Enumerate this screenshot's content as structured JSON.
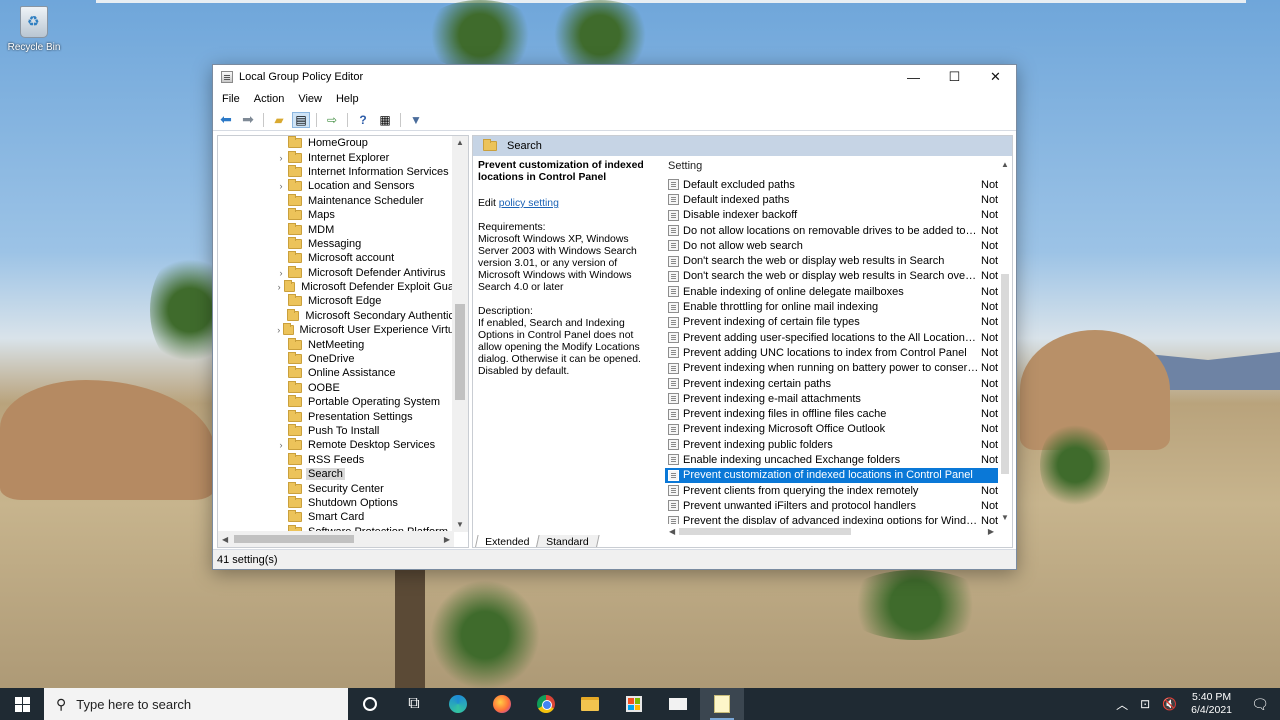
{
  "desktop": {
    "recycle_bin_label": "Recycle Bin"
  },
  "window": {
    "title": "Local Group Policy Editor",
    "controls": {
      "minimize": "—",
      "maximize": "☐",
      "close": "✕"
    },
    "menu": [
      "File",
      "Action",
      "View",
      "Help"
    ]
  },
  "tree": {
    "items": [
      {
        "label": "HomeGroup",
        "expandable": false
      },
      {
        "label": "Internet Explorer",
        "expandable": true
      },
      {
        "label": "Internet Information Services",
        "expandable": false
      },
      {
        "label": "Location and Sensors",
        "expandable": true
      },
      {
        "label": "Maintenance Scheduler",
        "expandable": false
      },
      {
        "label": "Maps",
        "expandable": false
      },
      {
        "label": "MDM",
        "expandable": false
      },
      {
        "label": "Messaging",
        "expandable": false
      },
      {
        "label": "Microsoft account",
        "expandable": false
      },
      {
        "label": "Microsoft Defender Antivirus",
        "expandable": true
      },
      {
        "label": "Microsoft Defender Exploit Gua",
        "expandable": true
      },
      {
        "label": "Microsoft Edge",
        "expandable": false
      },
      {
        "label": "Microsoft Secondary Authentic",
        "expandable": false
      },
      {
        "label": "Microsoft User Experience Virtu",
        "expandable": true
      },
      {
        "label": "NetMeeting",
        "expandable": false
      },
      {
        "label": "OneDrive",
        "expandable": false
      },
      {
        "label": "Online Assistance",
        "expandable": false
      },
      {
        "label": "OOBE",
        "expandable": false
      },
      {
        "label": "Portable Operating System",
        "expandable": false
      },
      {
        "label": "Presentation Settings",
        "expandable": false
      },
      {
        "label": "Push To Install",
        "expandable": false
      },
      {
        "label": "Remote Desktop Services",
        "expandable": true
      },
      {
        "label": "RSS Feeds",
        "expandable": false
      },
      {
        "label": "Search",
        "expandable": false,
        "selected": true
      },
      {
        "label": "Security Center",
        "expandable": false
      },
      {
        "label": "Shutdown Options",
        "expandable": false
      },
      {
        "label": "Smart Card",
        "expandable": false
      },
      {
        "label": "Software Protection Platform",
        "expandable": false
      }
    ]
  },
  "details": {
    "header": "Search",
    "policy_title": "Prevent customization of indexed locations in Control Panel",
    "edit_prefix": "Edit",
    "edit_link": "policy setting",
    "requirements": "Requirements:\nMicrosoft Windows XP, Windows Server 2003 with Windows Search version 3.01, or any version of Microsoft Windows with Windows Search 4.0 or later",
    "description": "Description:\nIf enabled, Search and Indexing Options in Control Panel does not allow opening the Modify Locations dialog. Otherwise it can be opened. Disabled by default.",
    "column_setting": "Setting",
    "settings": [
      {
        "name": "Default excluded paths",
        "state": "Not"
      },
      {
        "name": "Default indexed paths",
        "state": "Not"
      },
      {
        "name": "Disable indexer backoff",
        "state": "Not"
      },
      {
        "name": "Do not allow locations on removable drives to be added to li...",
        "state": "Not"
      },
      {
        "name": "Do not allow web search",
        "state": "Not"
      },
      {
        "name": "Don't search the web or display web results in Search",
        "state": "Not"
      },
      {
        "name": "Don't search the web or display web results in Search over ...",
        "state": "Not"
      },
      {
        "name": "Enable indexing of online delegate mailboxes",
        "state": "Not"
      },
      {
        "name": "Enable throttling for online mail indexing",
        "state": "Not"
      },
      {
        "name": "Prevent indexing of certain file types",
        "state": "Not"
      },
      {
        "name": "Prevent adding user-specified locations to the All Locations ...",
        "state": "Not"
      },
      {
        "name": "Prevent adding UNC locations to index from Control Panel",
        "state": "Not"
      },
      {
        "name": "Prevent indexing when running on battery power to conserv...",
        "state": "Not"
      },
      {
        "name": "Prevent indexing certain paths",
        "state": "Not"
      },
      {
        "name": "Prevent indexing e-mail attachments",
        "state": "Not"
      },
      {
        "name": "Prevent indexing files in offline files cache",
        "state": "Not"
      },
      {
        "name": "Prevent indexing Microsoft Office Outlook",
        "state": "Not"
      },
      {
        "name": "Prevent indexing public folders",
        "state": "Not"
      },
      {
        "name": "Enable indexing uncached Exchange folders",
        "state": "Not"
      },
      {
        "name": "Prevent customization of indexed locations in Control Panel",
        "state": "",
        "selected": true
      },
      {
        "name": "Prevent clients from querying the index remotely",
        "state": "Not"
      },
      {
        "name": "Prevent unwanted iFilters and protocol handlers",
        "state": "Not"
      },
      {
        "name": "Prevent the display of advanced indexing options for Windo...",
        "state": "Not"
      }
    ],
    "tabs": [
      "Extended",
      "Standard"
    ]
  },
  "status": {
    "text": "41 setting(s)"
  },
  "taskbar": {
    "search_placeholder": "Type here to search",
    "time": "5:40 PM",
    "date": "6/4/2021"
  }
}
